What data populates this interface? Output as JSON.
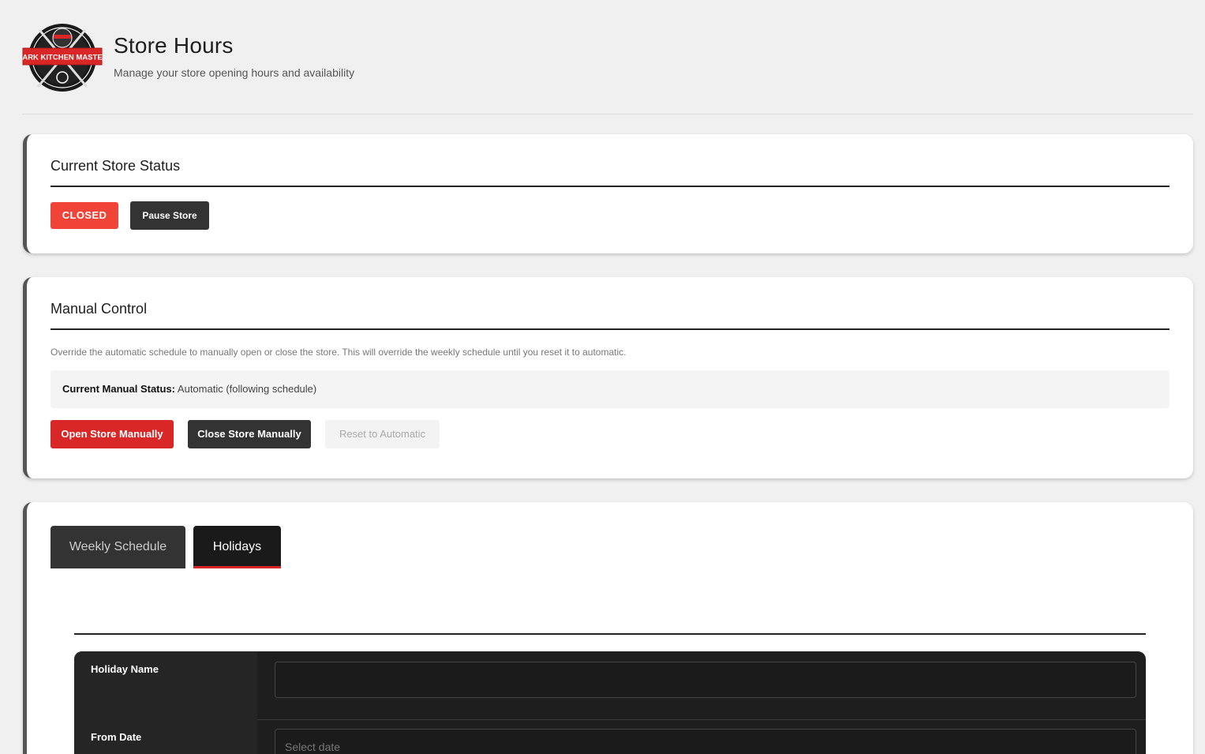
{
  "header": {
    "logo_text": "DARK KITCHEN MASTER",
    "title": "Store Hours",
    "subtitle": "Manage your store opening hours and availability"
  },
  "status_card": {
    "title": "Current Store Status",
    "status_badge": "CLOSED",
    "pause_button": "Pause Store"
  },
  "manual_card": {
    "title": "Manual Control",
    "description": "Override the automatic schedule to manually open or close the store. This will override the weekly schedule until you reset it to automatic.",
    "status_label": "Current Manual Status:",
    "status_value": "Automatic (following schedule)",
    "open_button": "Open Store Manually",
    "close_button": "Close Store Manually",
    "reset_button": "Reset to Automatic"
  },
  "tabs": [
    {
      "label": "Weekly Schedule",
      "active": false
    },
    {
      "label": "Holidays",
      "active": true
    }
  ],
  "holiday_form": {
    "name_label": "Holiday Name",
    "name_value": "",
    "from_label": "From Date",
    "from_placeholder": "Select date"
  },
  "colors": {
    "accent_red": "#d92626",
    "closed_badge": "#f04438",
    "dark": "#333333"
  }
}
